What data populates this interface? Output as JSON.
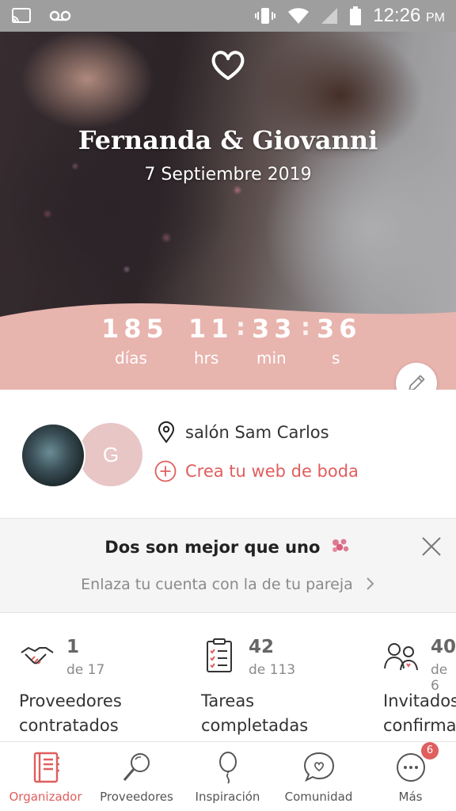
{
  "status_bar": {
    "time": "12:26",
    "ampm": "PM",
    "icons": [
      "cast-icon",
      "voicemail-icon",
      "vibrate-icon",
      "wifi-icon",
      "cellular-icon",
      "battery-icon"
    ]
  },
  "hero": {
    "couple_names": "Fernanda & Giovanni",
    "wedding_date": "7 Septiembre 2019",
    "accent_color": "#e8b4ae",
    "countdown": {
      "days": "185",
      "days_label": "días",
      "hours": "11",
      "hours_label": "hrs",
      "minutes": "33",
      "minutes_label": "min",
      "seconds": "36",
      "seconds_label": "s",
      "separator": ":"
    }
  },
  "couple": {
    "partner_initial": "G",
    "venue": "salón Sam Carlos",
    "create_web_label": "Crea tu web de boda"
  },
  "banner": {
    "title": "Dos son mejor que uno",
    "subtitle": "Enlaza tu cuenta con la de tu pareja"
  },
  "stats": [
    {
      "value": "1",
      "of": "de 17",
      "label_line1": "Proveedores",
      "label_line2": "contratados",
      "icon": "handshake-icon"
    },
    {
      "value": "42",
      "of": "de 113",
      "label_line1": "Tareas",
      "label_line2": "completadas",
      "icon": "checklist-icon"
    },
    {
      "value": "40",
      "of": "de 6",
      "label_line1": "Invitados",
      "label_line2": "confirma",
      "icon": "guests-icon"
    }
  ],
  "bottom_nav": {
    "items": [
      {
        "label": "Organizador",
        "icon": "notebook-icon",
        "active": true
      },
      {
        "label": "Proveedores",
        "icon": "magnifier-icon",
        "active": false
      },
      {
        "label": "Inspiración",
        "icon": "balloon-icon",
        "active": false
      },
      {
        "label": "Comunidad",
        "icon": "chat-heart-icon",
        "active": false
      },
      {
        "label": "Más",
        "icon": "more-icon",
        "active": false,
        "badge": "6"
      }
    ],
    "active_color": "#e05e5e"
  }
}
